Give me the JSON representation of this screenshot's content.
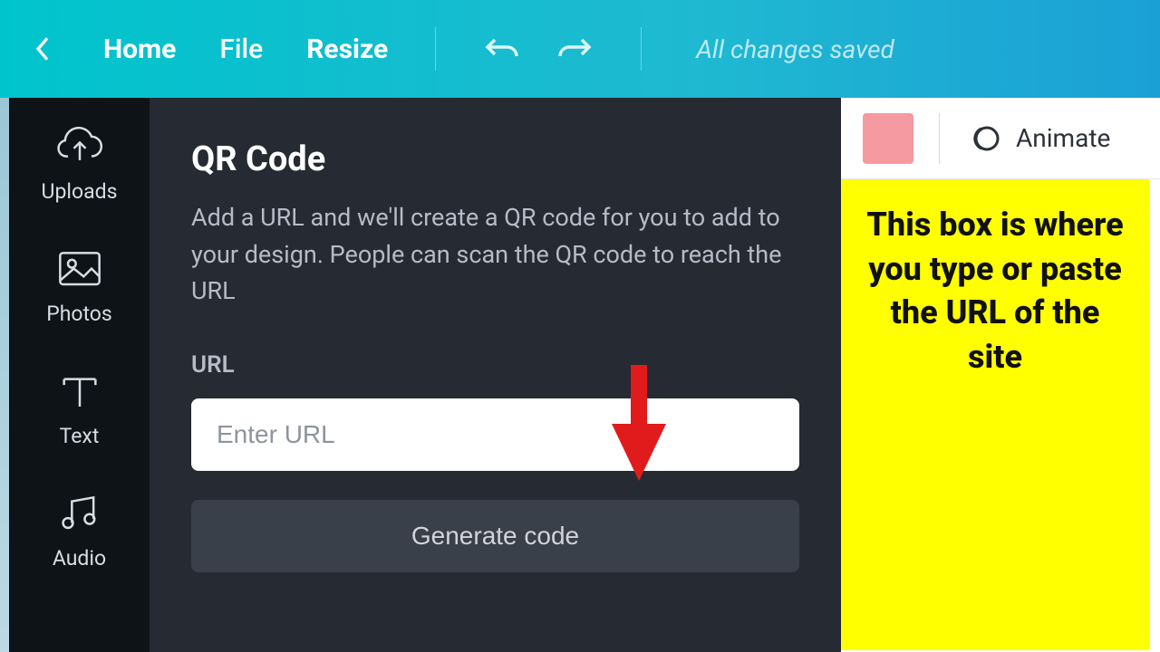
{
  "topbar": {
    "home": "Home",
    "file": "File",
    "resize": "Resize",
    "save_status": "All changes saved"
  },
  "sidebar": {
    "items": [
      {
        "label": "Uploads"
      },
      {
        "label": "Photos"
      },
      {
        "label": "Text"
      },
      {
        "label": "Audio"
      }
    ]
  },
  "panel": {
    "title": "QR Code",
    "description": "Add a URL and we'll create a QR code for you to add to your design. People can scan the QR code to reach the URL",
    "url_label": "URL",
    "url_placeholder": "Enter URL",
    "generate_label": "Generate code"
  },
  "editbar": {
    "swatch_color": "#f59aa0",
    "animate_label": "Animate"
  },
  "annotation": {
    "note_text": "This box is where you type or paste the URL of the site",
    "arrow_color": "#e11b1b"
  }
}
